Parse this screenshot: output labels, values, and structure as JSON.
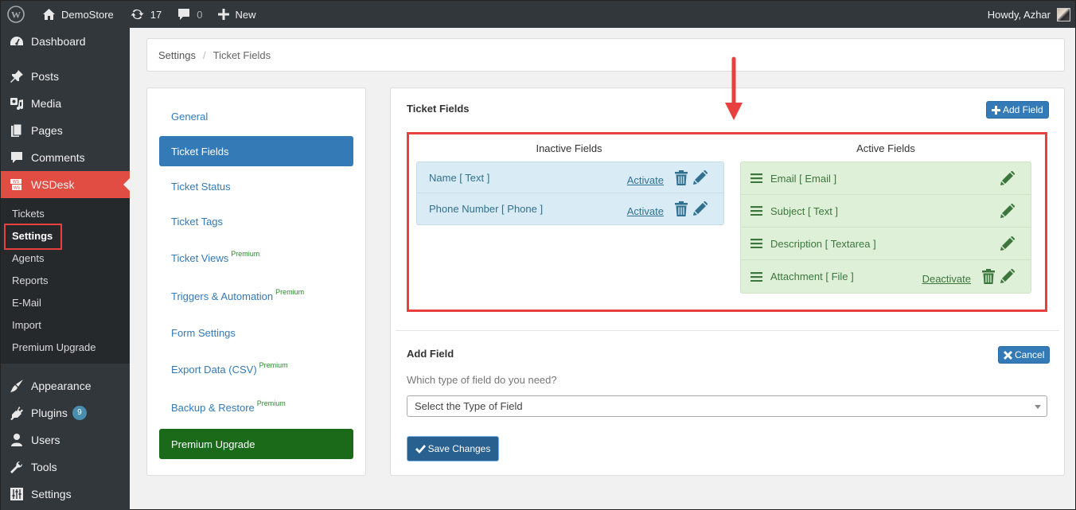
{
  "adminbar": {
    "site_name": "DemoStore",
    "updates_count": "17",
    "comments_count": "0",
    "new_label": "New",
    "greeting": "Howdy, Azhar"
  },
  "sidebar": {
    "menu": [
      {
        "label": "Dashboard",
        "icon": "dashboard-icon"
      },
      {
        "label": "Posts",
        "icon": "pin-icon"
      },
      {
        "label": "Media",
        "icon": "media-icon"
      },
      {
        "label": "Pages",
        "icon": "pages-icon"
      },
      {
        "label": "Comments",
        "icon": "comment-icon"
      },
      {
        "label": "WSDesk",
        "icon": "wsdesk-icon",
        "active": true
      }
    ],
    "submenu": [
      "Tickets",
      "Settings",
      "Agents",
      "Reports",
      "E-Mail",
      "Import",
      "Premium Upgrade"
    ],
    "submenu_current": "Settings",
    "menu_bottom": [
      {
        "label": "Appearance",
        "icon": "brush-icon"
      },
      {
        "label": "Plugins",
        "icon": "plug-icon",
        "badge": "9"
      },
      {
        "label": "Users",
        "icon": "user-icon"
      },
      {
        "label": "Tools",
        "icon": "wrench-icon"
      },
      {
        "label": "Settings",
        "icon": "sliders-icon"
      }
    ]
  },
  "breadcrumb": {
    "root": "Settings",
    "separator": "/",
    "current": "Ticket Fields"
  },
  "settings_nav": {
    "items": [
      {
        "label": "General"
      },
      {
        "label": "Ticket Fields",
        "active": true
      },
      {
        "label": "Ticket Status"
      },
      {
        "label": "Ticket Tags"
      },
      {
        "label": "Ticket Views",
        "badge": "Premium"
      },
      {
        "label": "Triggers & Automation",
        "badge": "Premium"
      },
      {
        "label": "Form Settings"
      },
      {
        "label": "Export Data (CSV)",
        "badge": "Premium"
      },
      {
        "label": "Backup & Restore",
        "badge": "Premium"
      },
      {
        "label": "Premium Upgrade",
        "upgrade": true
      }
    ]
  },
  "ticket_fields": {
    "title": "Ticket Fields",
    "add_field_label": "Add Field",
    "inactive_title": "Inactive Fields",
    "active_title": "Active Fields",
    "inactive_fields": [
      {
        "label": "Name [ Text ]",
        "action": "Activate"
      },
      {
        "label": "Phone Number [ Phone ]",
        "action": "Activate"
      }
    ],
    "active_fields": [
      {
        "label": "Email [ Email ]"
      },
      {
        "label": "Subject [ Text ]"
      },
      {
        "label": "Description [ Textarea ]"
      },
      {
        "label": "Attachment [ File ]",
        "action": "Deactivate"
      }
    ]
  },
  "add_field": {
    "title": "Add Field",
    "cancel_label": "Cancel",
    "question": "Which type of field do you need?",
    "select_value": "Select the Type of Field",
    "save_label": "Save Changes"
  },
  "colors": {
    "sidebar_bg": "#32373c",
    "wsdesk_active": "#e14d43",
    "primary": "#337ab7",
    "upgrade_green": "#1a6a1a",
    "annotation_red": "#e8403f",
    "inactive_bg": "#d9ecf5",
    "active_bg": "#dff0d8"
  }
}
